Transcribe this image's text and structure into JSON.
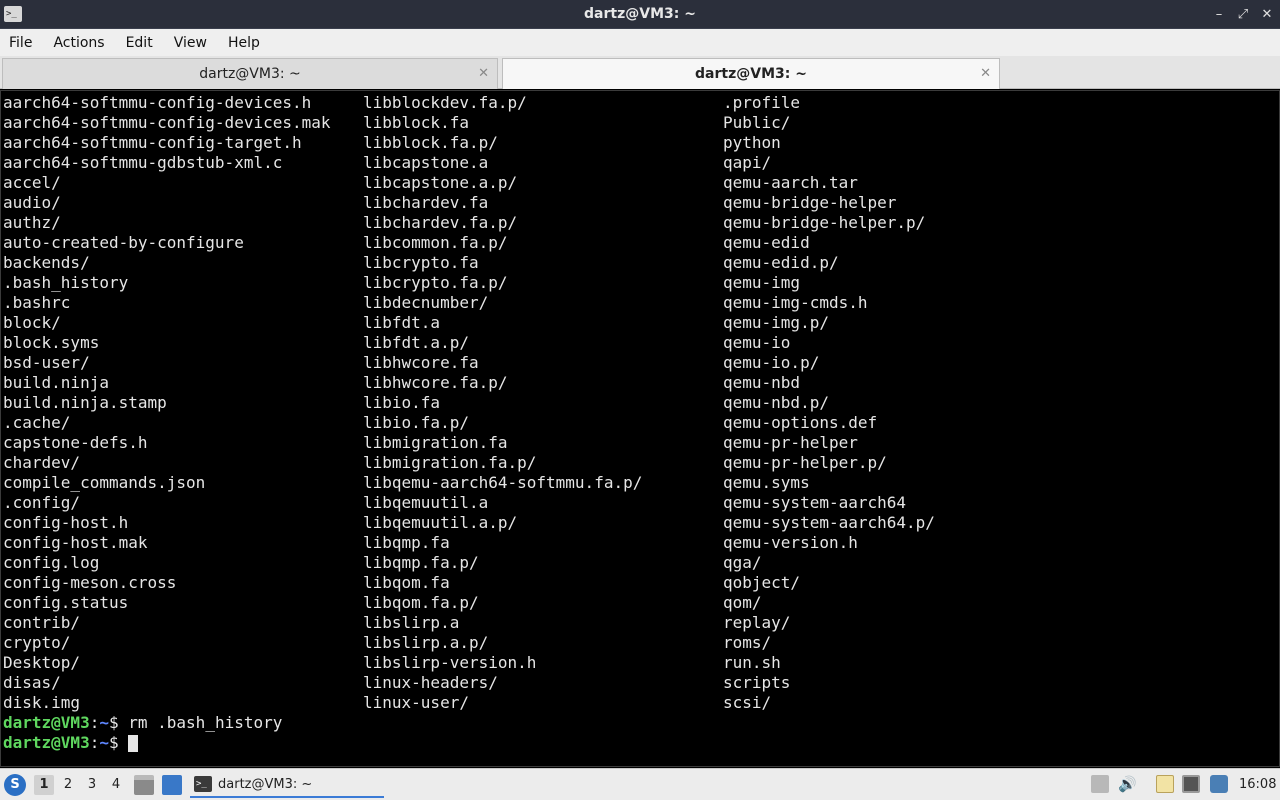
{
  "window": {
    "title": "dartz@VM3: ~",
    "app_icon_glyph": ">_",
    "controls": {
      "minimize": "–",
      "maximize": "⤢",
      "close": "✕"
    }
  },
  "menu": [
    "File",
    "Actions",
    "Edit",
    "View",
    "Help"
  ],
  "tabs": [
    {
      "label": "dartz@VM3: ~",
      "active": false
    },
    {
      "label": "dartz@VM3: ~",
      "active": true
    }
  ],
  "terminal": {
    "columns": [
      [
        "aarch64-softmmu-config-devices.h",
        "aarch64-softmmu-config-devices.mak",
        "aarch64-softmmu-config-target.h",
        "aarch64-softmmu-gdbstub-xml.c",
        "accel/",
        "audio/",
        "authz/",
        "auto-created-by-configure",
        "backends/",
        ".bash_history",
        ".bashrc",
        "block/",
        "block.syms",
        "bsd-user/",
        "build.ninja",
        "build.ninja.stamp",
        ".cache/",
        "capstone-defs.h",
        "chardev/",
        "compile_commands.json",
        ".config/",
        "config-host.h",
        "config-host.mak",
        "config.log",
        "config-meson.cross",
        "config.status",
        "contrib/",
        "crypto/",
        "Desktop/",
        "disas/",
        "disk.img"
      ],
      [
        "libblockdev.fa.p/",
        "libblock.fa",
        "libblock.fa.p/",
        "libcapstone.a",
        "libcapstone.a.p/",
        "libchardev.fa",
        "libchardev.fa.p/",
        "libcommon.fa.p/",
        "libcrypto.fa",
        "libcrypto.fa.p/",
        "libdecnumber/",
        "libfdt.a",
        "libfdt.a.p/",
        "libhwcore.fa",
        "libhwcore.fa.p/",
        "libio.fa",
        "libio.fa.p/",
        "libmigration.fa",
        "libmigration.fa.p/",
        "libqemu-aarch64-softmmu.fa.p/",
        "libqemuutil.a",
        "libqemuutil.a.p/",
        "libqmp.fa",
        "libqmp.fa.p/",
        "libqom.fa",
        "libqom.fa.p/",
        "libslirp.a",
        "libslirp.a.p/",
        "libslirp-version.h",
        "linux-headers/",
        "linux-user/"
      ],
      [
        ".profile",
        "Public/",
        "python",
        "qapi/",
        "qemu-aarch.tar",
        "qemu-bridge-helper",
        "qemu-bridge-helper.p/",
        "qemu-edid",
        "qemu-edid.p/",
        "qemu-img",
        "qemu-img-cmds.h",
        "qemu-img.p/",
        "qemu-io",
        "qemu-io.p/",
        "qemu-nbd",
        "qemu-nbd.p/",
        "qemu-options.def",
        "qemu-pr-helper",
        "qemu-pr-helper.p/",
        "qemu.syms",
        "qemu-system-aarch64",
        "qemu-system-aarch64.p/",
        "qemu-version.h",
        "qga/",
        "qobject/",
        "qom/",
        "replay/",
        "roms/",
        "run.sh",
        "scripts",
        "scsi/"
      ]
    ],
    "prompt": {
      "user_host": "dartz@VM3",
      "colon": ":",
      "path": "~",
      "symbol": "$ "
    },
    "history_command": "rm .bash_history",
    "current_input": ""
  },
  "taskbar": {
    "start_glyph": "S",
    "desktops": [
      "1",
      "2",
      "3",
      "4"
    ],
    "current_desktop": "1",
    "task": {
      "label": "dartz@VM3: ~",
      "icon_glyph": ">_"
    },
    "volume_glyph": "🔊",
    "clock": "16:08"
  }
}
